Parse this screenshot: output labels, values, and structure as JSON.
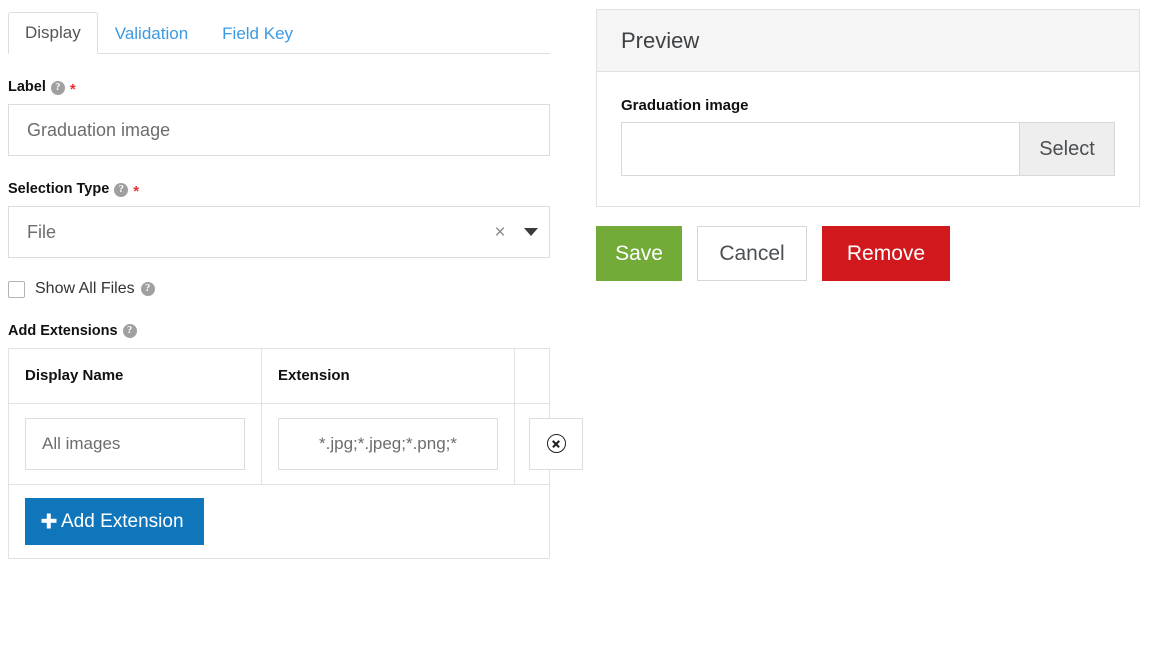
{
  "tabs": [
    {
      "label": "Display",
      "active": true
    },
    {
      "label": "Validation",
      "active": false
    },
    {
      "label": "Field Key",
      "active": false
    }
  ],
  "form": {
    "label_field": {
      "label": "Label",
      "required_marker": "*",
      "help_glyph": "?",
      "value": "Graduation image",
      "placeholder": "Graduation image"
    },
    "selection_type": {
      "label": "Selection Type",
      "required_marker": "*",
      "help_glyph": "?",
      "selected": "File",
      "clear_glyph": "×"
    },
    "show_all_files": {
      "label": "Show All Files",
      "help_glyph": "?",
      "checked": false
    },
    "add_extensions": {
      "label": "Add Extensions",
      "help_glyph": "?",
      "columns": [
        "Display Name",
        "Extension",
        ""
      ],
      "rows": [
        {
          "display_name": "All images",
          "extension": "*.jpg;*.jpeg;*.png;*",
          "delete_icon": "remove-circle-icon"
        }
      ],
      "add_button": "Add Extension"
    }
  },
  "preview": {
    "title": "Preview",
    "field_label": "Graduation image",
    "field_value": "",
    "select_button": "Select"
  },
  "actions": {
    "save": "Save",
    "cancel": "Cancel",
    "remove": "Remove"
  },
  "colors": {
    "tab_link": "#3b9ae1",
    "required": "#e33131",
    "add_button": "#0f76bc",
    "save": "#73ab39",
    "remove": "#d0181d",
    "panel_head": "#f5f5f5"
  }
}
